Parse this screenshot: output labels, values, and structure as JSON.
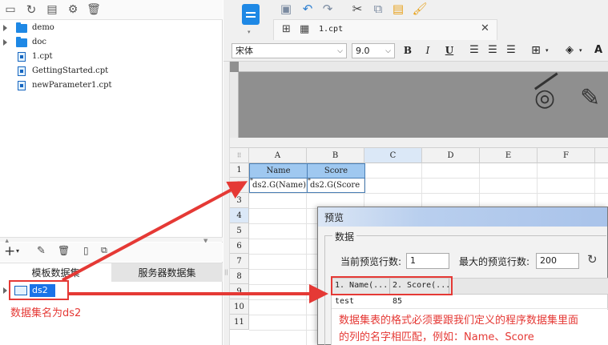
{
  "tree": {
    "items": [
      {
        "label": "demo",
        "type": "folder"
      },
      {
        "label": "doc",
        "type": "folder"
      },
      {
        "label": "1.cpt",
        "type": "file"
      },
      {
        "label": "GettingStarted.cpt",
        "type": "file"
      },
      {
        "label": "newParameter1.cpt",
        "type": "file"
      }
    ]
  },
  "datasets": {
    "tabs": [
      {
        "label": "模板数据集",
        "active": true
      },
      {
        "label": "服务器数据集",
        "active": false
      }
    ],
    "items": [
      {
        "label": "ds2",
        "selected": true
      }
    ]
  },
  "editor": {
    "tab_label": "1.cpt",
    "font_name": "宋体",
    "font_size": "9.0",
    "bold": "B",
    "italic": "I",
    "underline": "U",
    "color_letter": "A"
  },
  "grid": {
    "columns": [
      "A",
      "B",
      "C",
      "D",
      "E",
      "F"
    ],
    "rows": [
      "1",
      "2",
      "3",
      "4",
      "5",
      "6",
      "7",
      "8",
      "9",
      "10",
      "11"
    ],
    "cells": {
      "A1": "Name",
      "B1": "Score",
      "A2": "ds2.G(Name)",
      "B2": "ds2.G(Score"
    }
  },
  "preview": {
    "title": "预览",
    "group": "数据",
    "current_rows_label": "当前预览行数:",
    "current_rows_value": "1",
    "max_rows_label": "最大的预览行数:",
    "max_rows_value": "200",
    "headers": [
      "1. Name(...",
      "2. Score(..."
    ],
    "rows": [
      [
        "test",
        "85"
      ]
    ]
  },
  "annotations": {
    "dataset_name": "数据集名为ds2",
    "format_note_line1": "数据集表的格式必须要跟我们定义的程序数据集里面",
    "format_note_line2": "的列的名字相匹配，例如：Name、Score"
  },
  "colors": {
    "accent_blue": "#1e88e5",
    "annotation_red": "#e53935",
    "selection_blue": "#1a73e8"
  }
}
